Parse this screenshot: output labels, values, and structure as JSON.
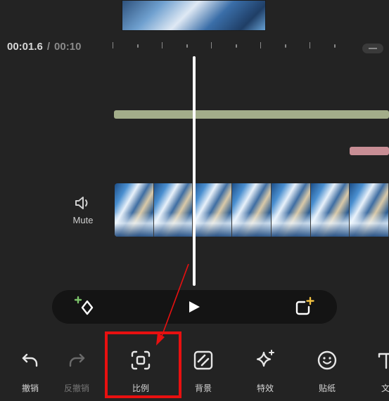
{
  "timecode": {
    "current": "00:01.6",
    "separator": "/",
    "total": "00:10"
  },
  "tracks": {
    "mute_label": "Mute"
  },
  "colors": {
    "background": "#232323",
    "music_track": "#a3ad8a",
    "sticker_track": "#c88e95",
    "playhead": "#ffffff",
    "highlight": "#e81010",
    "keyframe_plus": "#7cc36a",
    "add_plus": "#f0c040"
  },
  "playback": {
    "add_keyframe_icon": "diamond-plus-icon",
    "play_icon": "play-icon",
    "fullscreen_icon": "frame-plus-icon"
  },
  "toolbar": {
    "items": [
      {
        "label": "撤销",
        "icon": "undo-icon"
      },
      {
        "label": "反撤销",
        "icon": "redo-icon",
        "disabled": true
      },
      {
        "label": "比例",
        "icon": "ratio-icon",
        "highlighted": true
      },
      {
        "label": "背景",
        "icon": "background-icon"
      },
      {
        "label": "特效",
        "icon": "sparkle-icon"
      },
      {
        "label": "贴纸",
        "icon": "sticker-icon"
      },
      {
        "label": "文",
        "icon": "text-icon"
      }
    ]
  }
}
